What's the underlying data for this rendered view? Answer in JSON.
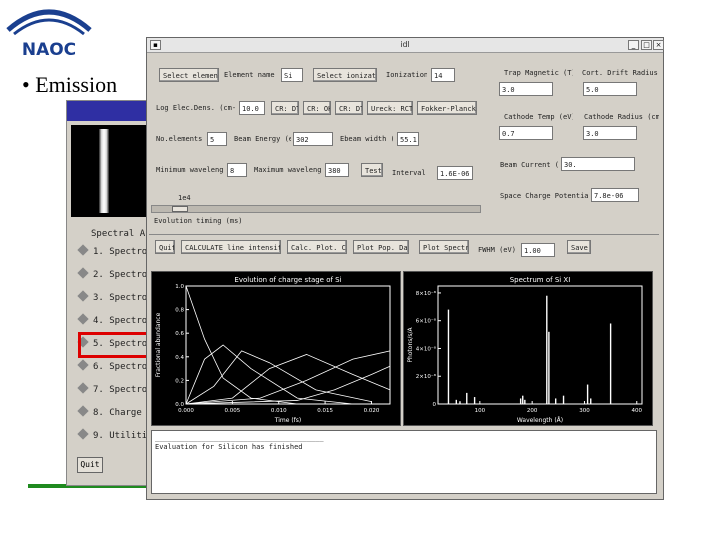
{
  "slide": {
    "logo": "NAOC",
    "bullet": "• Emission"
  },
  "back_window": {
    "heading": "Spectral An",
    "items": [
      {
        "label": "1.  Spectro"
      },
      {
        "label": "2.  Spectro"
      },
      {
        "label": "3.  Spectro"
      },
      {
        "label": "4.  Spectro"
      },
      {
        "label": "5.  Spectro"
      },
      {
        "label": "6.  Spectro"
      },
      {
        "label": "7.  Spectro"
      },
      {
        "label": "8.  Charge"
      },
      {
        "label": "9.  Utiliti"
      }
    ],
    "quit": "Quit"
  },
  "window": {
    "title": "idl",
    "row1": {
      "select_element": "Select element",
      "element_label": "Element name",
      "element_value": "Si",
      "select_ionization": "Select ionization",
      "ion_label": "Ionization",
      "ion_value": "14"
    },
    "row2": {
      "density_label": "Log Elec.Dens. (cm-3)",
      "density_value": "10.0",
      "b1": "CR: DT",
      "b2": "CR: OH",
      "b3": "CR: DT",
      "b4": "Ureck: RCTMS",
      "b5": "Fokker-Planck DT"
    },
    "row3": {
      "levels_label": "No.elements",
      "levels_value": "5",
      "beam_label": "Beam Energy (eV)",
      "beam_value": "302",
      "ebeam_label": "Ebeam width (eV)",
      "ebeam_value": "55.1"
    },
    "row4": {
      "minwl_label": "Minimum wavelength",
      "minwl_value": "8",
      "maxwl_label": "Maximum wavelength",
      "maxwl_value": "380",
      "test": "Test",
      "step_label": "Interval (fs)",
      "step_value": "1.6E-06"
    },
    "right": {
      "trap_label": "Trap Magnetic (T)",
      "trap_value": "3.0",
      "drift_label": "Cort. Drift Radius (um)",
      "drift_value": "5.0",
      "cathode_label": "Cathode Temp (eV)",
      "cathode_value": "0.7",
      "cradius_label": "Cathode Radius (cm)",
      "cradius_value": "3.0",
      "current_label": "Beam Current (mA)",
      "current_value": "30.",
      "space_label": "Space Charge Potential (eV)",
      "space_value": "7.8e-06"
    },
    "slider": {
      "value": "1e4",
      "label": "Evolution timing (ms)"
    },
    "actions": {
      "quit": "Quit",
      "b1": "CALCULATE line intensities",
      "b2": "Calc. Plot. Charge",
      "b3": "Plot Pop. Dates",
      "b4": "Plot Spectrum",
      "fwhm_label": "FWHM (eV) =",
      "fwhm_value": "1.00",
      "save": "Save"
    },
    "console": [
      "________________________________________",
      "Evaluation for Silicon has finished"
    ]
  },
  "chart_data": [
    {
      "type": "line",
      "title": "Evolution of charge stage of Si",
      "xlabel": "Time (fs)",
      "ylabel": "Fractional abundance",
      "xticks": [
        "0.000",
        "0.005",
        "0.010",
        "0.015",
        "0.020"
      ],
      "yticks": [
        "0.0",
        "0.2",
        "0.4",
        "0.6",
        "0.8",
        "1.0"
      ],
      "xlim": [
        0,
        0.022
      ],
      "ylim": [
        0,
        1.0
      ],
      "series": [
        {
          "values": [
            [
              0,
              1.0
            ],
            [
              0.002,
              0.55
            ],
            [
              0.004,
              0.22
            ],
            [
              0.007,
              0.05
            ],
            [
              0.012,
              0.0
            ]
          ]
        },
        {
          "values": [
            [
              0,
              0.0
            ],
            [
              0.002,
              0.38
            ],
            [
              0.004,
              0.5
            ],
            [
              0.007,
              0.3
            ],
            [
              0.012,
              0.05
            ],
            [
              0.018,
              0.0
            ]
          ]
        },
        {
          "values": [
            [
              0,
              0.0
            ],
            [
              0.003,
              0.15
            ],
            [
              0.006,
              0.45
            ],
            [
              0.009,
              0.35
            ],
            [
              0.014,
              0.12
            ],
            [
              0.02,
              0.02
            ]
          ]
        },
        {
          "values": [
            [
              0,
              0.0
            ],
            [
              0.005,
              0.05
            ],
            [
              0.009,
              0.3
            ],
            [
              0.013,
              0.42
            ],
            [
              0.018,
              0.25
            ],
            [
              0.022,
              0.12
            ]
          ]
        },
        {
          "values": [
            [
              0,
              0.0
            ],
            [
              0.008,
              0.05
            ],
            [
              0.013,
              0.2
            ],
            [
              0.018,
              0.38
            ],
            [
              0.022,
              0.45
            ]
          ]
        },
        {
          "values": [
            [
              0,
              0.0
            ],
            [
              0.012,
              0.03
            ],
            [
              0.016,
              0.12
            ],
            [
              0.02,
              0.25
            ],
            [
              0.022,
              0.32
            ]
          ]
        }
      ]
    },
    {
      "type": "bar",
      "title": "Spectrum of Si XI",
      "xlabel": "Wavelength (Å)",
      "ylabel": "Photons/s/A",
      "xticks": [
        "100",
        "200",
        "300",
        "400"
      ],
      "yticks": [
        "0",
        "2×10⁻⁸",
        "4×10⁻⁸",
        "6×10⁻⁸",
        "8×10⁻⁸"
      ],
      "xlim": [
        20,
        410
      ],
      "ylim": [
        0,
        8.5e-08
      ],
      "x": [
        40,
        55,
        62,
        75,
        90,
        178,
        182,
        186,
        228,
        232,
        245,
        260,
        306,
        312,
        350
      ],
      "values": [
        6.8e-08,
        3e-09,
        2e-09,
        8e-09,
        5e-09,
        4e-09,
        6e-09,
        3e-09,
        7.8e-08,
        5.2e-08,
        4e-09,
        6e-09,
        1.4e-08,
        4e-09,
        5.8e-08
      ]
    }
  ]
}
